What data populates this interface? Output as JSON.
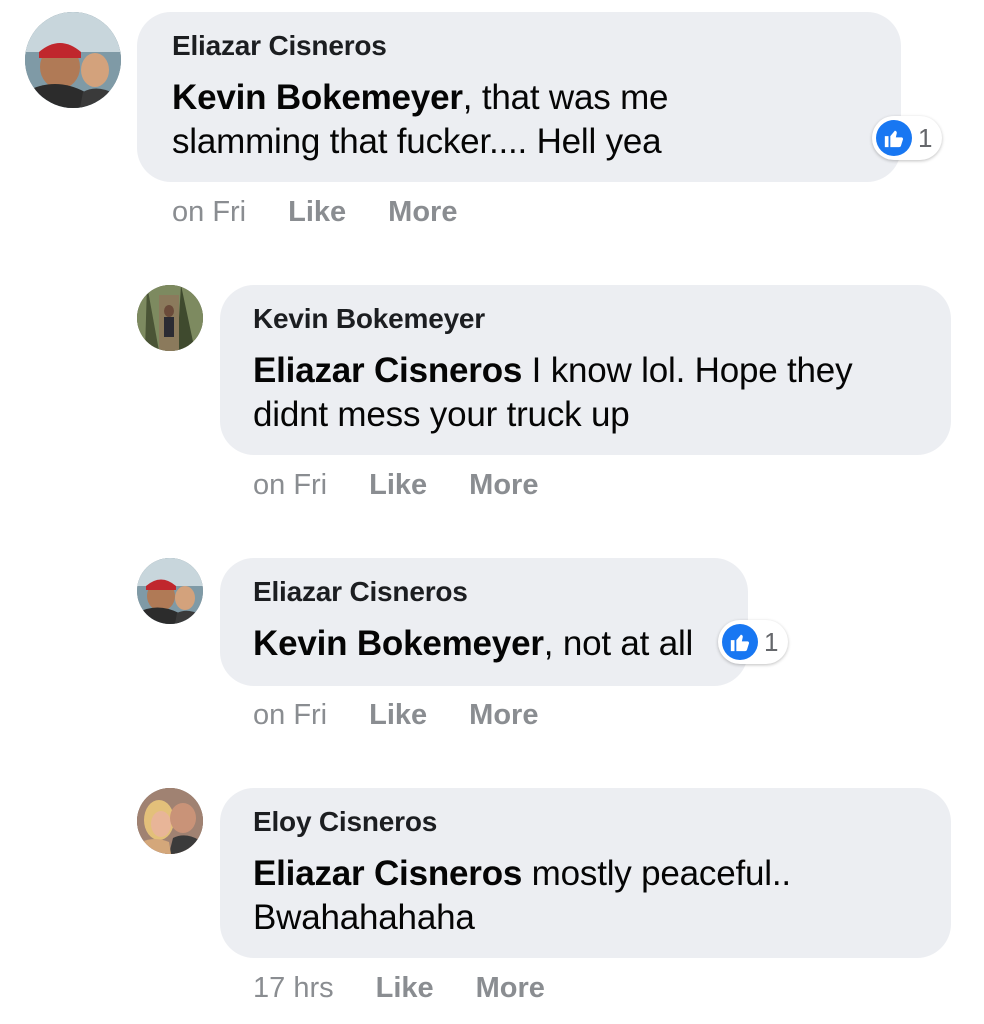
{
  "comments": [
    {
      "author": "Eliazar Cisneros",
      "mention": "Kevin Bokemeyer",
      "text_line1": ", that was me",
      "text_line2": "slamming that fucker.... Hell yea",
      "time": "on Fri",
      "like_label": "Like",
      "more_label": "More",
      "reaction_count": "1",
      "avatar_icon": "user-avatar-icon"
    },
    {
      "author": "Kevin Bokemeyer",
      "mention": "Eliazar Cisneros",
      "text_line1": " I know lol. Hope they",
      "text_line2": "didnt mess your truck up",
      "time": "on Fri",
      "like_label": "Like",
      "more_label": "More",
      "avatar_icon": "user-avatar-icon"
    },
    {
      "author": "Eliazar Cisneros",
      "mention": "Kevin Bokemeyer",
      "text_line1": ", not at all",
      "time": "on Fri",
      "like_label": "Like",
      "more_label": "More",
      "reaction_count": "1",
      "avatar_icon": "user-avatar-icon"
    },
    {
      "author": "Eloy Cisneros",
      "mention": "Eliazar Cisneros",
      "text_line1": " mostly peaceful..",
      "text_line2": "Bwahahahaha",
      "time": "17 hrs",
      "like_label": "Like",
      "more_label": "More",
      "avatar_icon": "user-avatar-icon"
    }
  ],
  "colors": {
    "bubble": "#eceef2",
    "meta_text": "#8a8d91",
    "like_blue": "#1877f2"
  }
}
